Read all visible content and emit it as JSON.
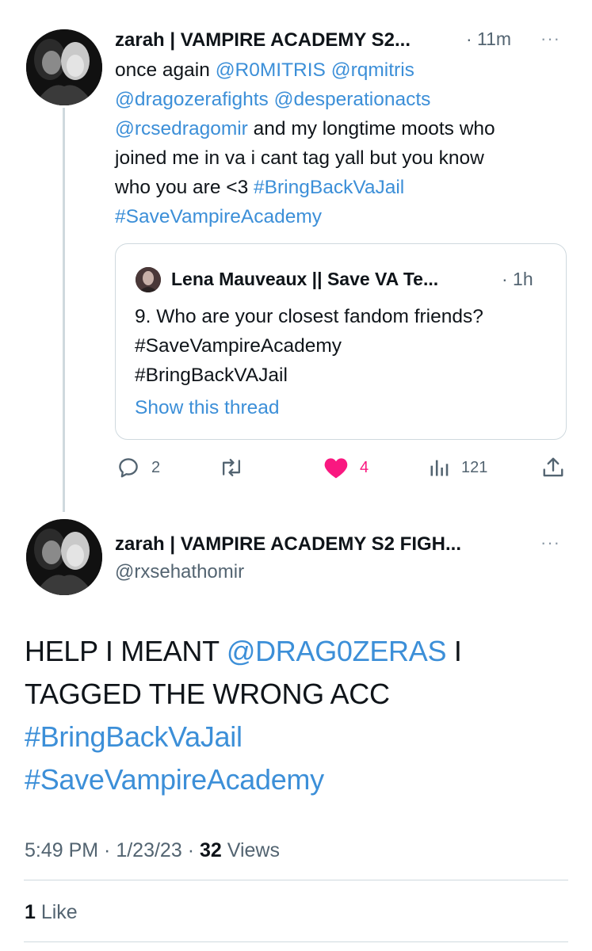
{
  "tweet1": {
    "display_name": "zarah | VAMPIRE ACADEMY S2...",
    "time": "· 11m",
    "more": "···",
    "text": {
      "line1_prefix": "once again ",
      "mention1": "@R0MITRIS",
      "mention2": "@rqmitris",
      "mention3": "@dragozerafights",
      "mention4": "@desperationacts",
      "mention5": "@rcsedragomir",
      "line3_suffix": " and my longtime moots who",
      "line4": "joined me in va i cant tag yall but you know",
      "line5_prefix": "who you are <3 ",
      "hashtag1": "#BringBackVaJail",
      "hashtag2": "#SaveVampireAcademy"
    },
    "quote": {
      "display_name": "Lena Mauveaux || Save VA Te...",
      "time": "· 1h",
      "line1": "9. Who are your closest fandom friends?",
      "line2": "#SaveVampireAcademy",
      "line3": "#BringBackVAJail",
      "show_thread": "Show this thread"
    },
    "actions": {
      "replies": "2",
      "retweets": "",
      "likes": "4",
      "views": "121"
    }
  },
  "tweet2": {
    "display_name": "zarah | VAMPIRE ACADEMY S2 FIGH...",
    "handle": "@rxsehathomir",
    "more": "···",
    "text": {
      "line1_prefix": "HELP I MEANT ",
      "mention": "@DRAG0ZERAS",
      "line1_suffix": " I",
      "line2": "TAGGED THE WRONG ACC",
      "hashtag1": "#BringBackVaJail",
      "hashtag2": "#SaveVampireAcademy"
    },
    "meta": {
      "time": "5:49 PM",
      "sep1": " · ",
      "date": "1/23/23",
      "sep2": " · ",
      "views_count": "32",
      "views_label": " Views"
    },
    "likes": {
      "count": "1",
      "label": " Like"
    }
  },
  "colors": {
    "link": "#3c8fd8",
    "like_heart": "#f91880",
    "muted": "#536471",
    "border": "#cfd9de"
  }
}
